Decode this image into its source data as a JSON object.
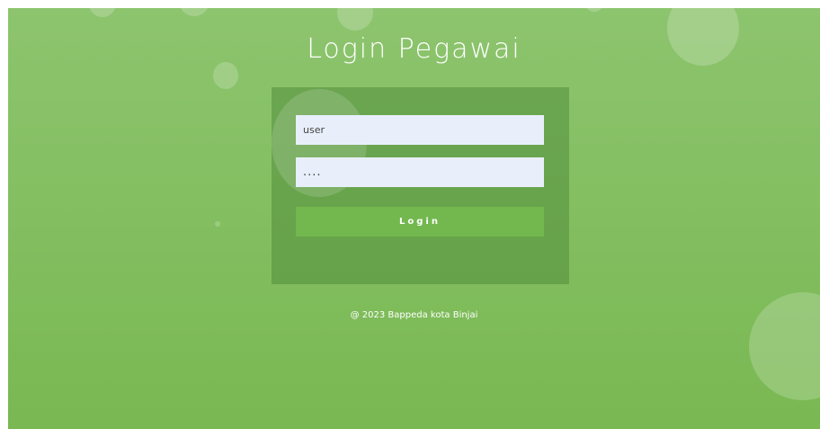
{
  "page": {
    "title": "Login Pegawai",
    "footer": "@ 2023 Bappeda kota Binjai"
  },
  "form": {
    "username_value": "user",
    "password_value": "....",
    "login_label": "Login"
  },
  "colors": {
    "background_top": "#8dc46e",
    "background_bottom": "#79b852",
    "panel": "#6a9e50",
    "button": "#73b84f",
    "input": "#e8effb"
  }
}
